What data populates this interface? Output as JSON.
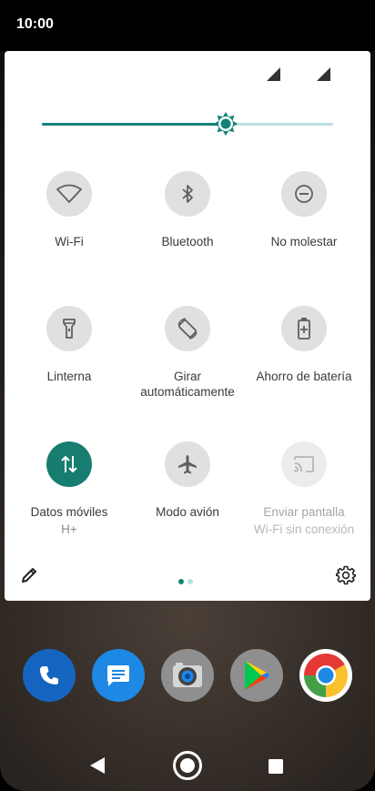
{
  "status_bar": {
    "time": "10:00"
  },
  "brightness": {
    "level": 0.63
  },
  "tiles": [
    {
      "label": "Wi-Fi",
      "icon": "wifi-icon"
    },
    {
      "label": "Bluetooth",
      "icon": "bluetooth-icon"
    },
    {
      "label": "No molestar",
      "icon": "do-not-disturb-icon"
    },
    {
      "label": "Linterna",
      "icon": "flashlight-icon"
    },
    {
      "label": "Girar automáticamente",
      "label_line1": "Girar",
      "label_line2": "automáticamente",
      "icon": "auto-rotate-icon"
    },
    {
      "label": "Ahorro de batería",
      "icon": "battery-saver-icon"
    },
    {
      "label": "Datos móviles",
      "sublabel": "H+",
      "icon": "mobile-data-icon",
      "active": true
    },
    {
      "label": "Modo avión",
      "icon": "airplane-icon"
    },
    {
      "label": "Enviar pantalla",
      "sublabel": "Wi-Fi sin conexión",
      "icon": "cast-icon",
      "disabled": true
    }
  ],
  "page_indicator": {
    "pages": 2,
    "current": 1
  },
  "colors": {
    "accent": "#148377",
    "accent_light": "#b9e0df",
    "tile_inactive": "#e0e0e0",
    "icon_dark": "#4a4a4a"
  },
  "dock": [
    {
      "name": "phone-app",
      "icon": "phone-icon",
      "color": "#1565c0"
    },
    {
      "name": "messages-app",
      "icon": "messages-icon",
      "color": "#1e88e5"
    },
    {
      "name": "camera-app",
      "icon": "camera-icon",
      "color": "#9e9e9e"
    },
    {
      "name": "play-store-app",
      "icon": "play-store-icon",
      "color": "#9e9e9e"
    },
    {
      "name": "chrome-app",
      "icon": "chrome-icon",
      "color": "#e53935"
    }
  ]
}
